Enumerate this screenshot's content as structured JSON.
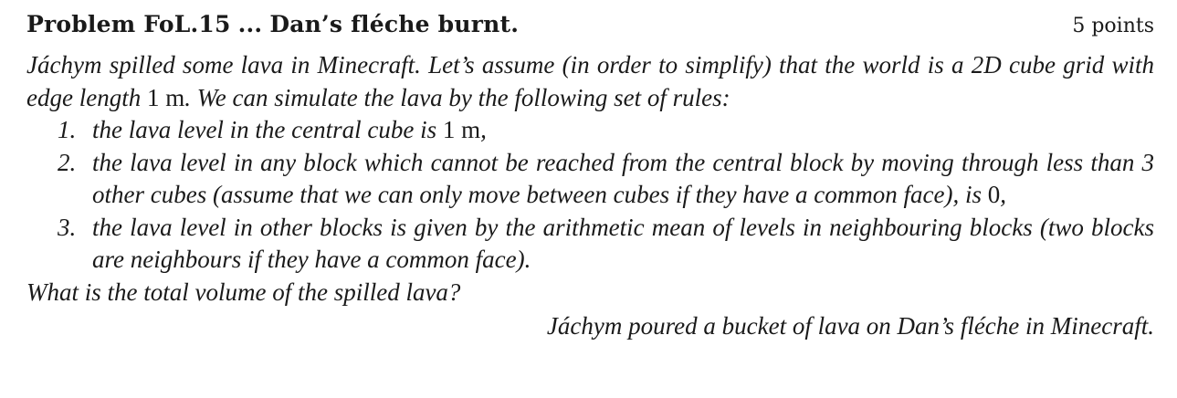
{
  "header": {
    "problem_id": "Problem FoL.15",
    "separator": "...",
    "title": "Dan’s fléche burnt.",
    "points": "5 points"
  },
  "intro": {
    "part1": "Jáchym spilled some lava in Minecraft. Let’s assume (in order to simplify) that the world is a 2D cube grid with edge length ",
    "edge_length": "1 m",
    "part2": ". We can simulate the lava by the following set of rules:"
  },
  "rules": [
    {
      "number": "1.",
      "text_before": "the lava level in the central cube is ",
      "value": "1 m",
      "text_after": ","
    },
    {
      "number": "2.",
      "text_before": "the lava level in any block which cannot be reached from the central block by moving through less than 3 other cubes (assume that we can only move between cubes if they have a common face), is ",
      "value": "0",
      "text_after": ","
    },
    {
      "number": "3.",
      "text_before": "the lava level in other blocks is given by the arithmetic mean of levels in neighbouring blocks (two blocks are neighbours if they have a common face).",
      "value": "",
      "text_after": ""
    }
  ],
  "question": "What is the total volume of the spilled lava?",
  "caption": "Jáchym poured a bucket of lava on Dan’s fléche in Minecraft."
}
